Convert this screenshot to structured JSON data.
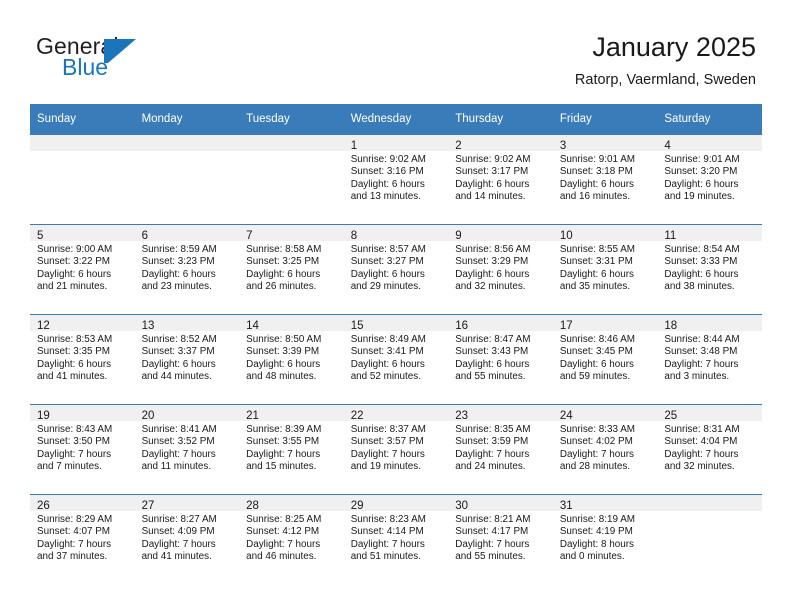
{
  "logo": {
    "word1": "General",
    "word2": "Blue",
    "icon": "triangle-logo-mark",
    "color_dark": "#231f20",
    "color_blue": "#1b75bb"
  },
  "header": {
    "title": "January 2025",
    "location": "Ratorp, Vaermland, Sweden"
  },
  "theme": {
    "header_blue": "#3a7cb9",
    "daynum_band": "#f0f0f0",
    "text": "#1a1a1a"
  },
  "calendar": {
    "weekday_headers": [
      "Sunday",
      "Monday",
      "Tuesday",
      "Wednesday",
      "Thursday",
      "Friday",
      "Saturday"
    ],
    "weeks": [
      [
        {
          "day": "",
          "sunrise": "",
          "sunset": "",
          "daylight1": "",
          "daylight2": ""
        },
        {
          "day": "",
          "sunrise": "",
          "sunset": "",
          "daylight1": "",
          "daylight2": ""
        },
        {
          "day": "",
          "sunrise": "",
          "sunset": "",
          "daylight1": "",
          "daylight2": ""
        },
        {
          "day": "1",
          "sunrise": "Sunrise: 9:02 AM",
          "sunset": "Sunset: 3:16 PM",
          "daylight1": "Daylight: 6 hours",
          "daylight2": "and 13 minutes."
        },
        {
          "day": "2",
          "sunrise": "Sunrise: 9:02 AM",
          "sunset": "Sunset: 3:17 PM",
          "daylight1": "Daylight: 6 hours",
          "daylight2": "and 14 minutes."
        },
        {
          "day": "3",
          "sunrise": "Sunrise: 9:01 AM",
          "sunset": "Sunset: 3:18 PM",
          "daylight1": "Daylight: 6 hours",
          "daylight2": "and 16 minutes."
        },
        {
          "day": "4",
          "sunrise": "Sunrise: 9:01 AM",
          "sunset": "Sunset: 3:20 PM",
          "daylight1": "Daylight: 6 hours",
          "daylight2": "and 19 minutes."
        }
      ],
      [
        {
          "day": "5",
          "sunrise": "Sunrise: 9:00 AM",
          "sunset": "Sunset: 3:22 PM",
          "daylight1": "Daylight: 6 hours",
          "daylight2": "and 21 minutes."
        },
        {
          "day": "6",
          "sunrise": "Sunrise: 8:59 AM",
          "sunset": "Sunset: 3:23 PM",
          "daylight1": "Daylight: 6 hours",
          "daylight2": "and 23 minutes."
        },
        {
          "day": "7",
          "sunrise": "Sunrise: 8:58 AM",
          "sunset": "Sunset: 3:25 PM",
          "daylight1": "Daylight: 6 hours",
          "daylight2": "and 26 minutes."
        },
        {
          "day": "8",
          "sunrise": "Sunrise: 8:57 AM",
          "sunset": "Sunset: 3:27 PM",
          "daylight1": "Daylight: 6 hours",
          "daylight2": "and 29 minutes."
        },
        {
          "day": "9",
          "sunrise": "Sunrise: 8:56 AM",
          "sunset": "Sunset: 3:29 PM",
          "daylight1": "Daylight: 6 hours",
          "daylight2": "and 32 minutes."
        },
        {
          "day": "10",
          "sunrise": "Sunrise: 8:55 AM",
          "sunset": "Sunset: 3:31 PM",
          "daylight1": "Daylight: 6 hours",
          "daylight2": "and 35 minutes."
        },
        {
          "day": "11",
          "sunrise": "Sunrise: 8:54 AM",
          "sunset": "Sunset: 3:33 PM",
          "daylight1": "Daylight: 6 hours",
          "daylight2": "and 38 minutes."
        }
      ],
      [
        {
          "day": "12",
          "sunrise": "Sunrise: 8:53 AM",
          "sunset": "Sunset: 3:35 PM",
          "daylight1": "Daylight: 6 hours",
          "daylight2": "and 41 minutes."
        },
        {
          "day": "13",
          "sunrise": "Sunrise: 8:52 AM",
          "sunset": "Sunset: 3:37 PM",
          "daylight1": "Daylight: 6 hours",
          "daylight2": "and 44 minutes."
        },
        {
          "day": "14",
          "sunrise": "Sunrise: 8:50 AM",
          "sunset": "Sunset: 3:39 PM",
          "daylight1": "Daylight: 6 hours",
          "daylight2": "and 48 minutes."
        },
        {
          "day": "15",
          "sunrise": "Sunrise: 8:49 AM",
          "sunset": "Sunset: 3:41 PM",
          "daylight1": "Daylight: 6 hours",
          "daylight2": "and 52 minutes."
        },
        {
          "day": "16",
          "sunrise": "Sunrise: 8:47 AM",
          "sunset": "Sunset: 3:43 PM",
          "daylight1": "Daylight: 6 hours",
          "daylight2": "and 55 minutes."
        },
        {
          "day": "17",
          "sunrise": "Sunrise: 8:46 AM",
          "sunset": "Sunset: 3:45 PM",
          "daylight1": "Daylight: 6 hours",
          "daylight2": "and 59 minutes."
        },
        {
          "day": "18",
          "sunrise": "Sunrise: 8:44 AM",
          "sunset": "Sunset: 3:48 PM",
          "daylight1": "Daylight: 7 hours",
          "daylight2": "and 3 minutes."
        }
      ],
      [
        {
          "day": "19",
          "sunrise": "Sunrise: 8:43 AM",
          "sunset": "Sunset: 3:50 PM",
          "daylight1": "Daylight: 7 hours",
          "daylight2": "and 7 minutes."
        },
        {
          "day": "20",
          "sunrise": "Sunrise: 8:41 AM",
          "sunset": "Sunset: 3:52 PM",
          "daylight1": "Daylight: 7 hours",
          "daylight2": "and 11 minutes."
        },
        {
          "day": "21",
          "sunrise": "Sunrise: 8:39 AM",
          "sunset": "Sunset: 3:55 PM",
          "daylight1": "Daylight: 7 hours",
          "daylight2": "and 15 minutes."
        },
        {
          "day": "22",
          "sunrise": "Sunrise: 8:37 AM",
          "sunset": "Sunset: 3:57 PM",
          "daylight1": "Daylight: 7 hours",
          "daylight2": "and 19 minutes."
        },
        {
          "day": "23",
          "sunrise": "Sunrise: 8:35 AM",
          "sunset": "Sunset: 3:59 PM",
          "daylight1": "Daylight: 7 hours",
          "daylight2": "and 24 minutes."
        },
        {
          "day": "24",
          "sunrise": "Sunrise: 8:33 AM",
          "sunset": "Sunset: 4:02 PM",
          "daylight1": "Daylight: 7 hours",
          "daylight2": "and 28 minutes."
        },
        {
          "day": "25",
          "sunrise": "Sunrise: 8:31 AM",
          "sunset": "Sunset: 4:04 PM",
          "daylight1": "Daylight: 7 hours",
          "daylight2": "and 32 minutes."
        }
      ],
      [
        {
          "day": "26",
          "sunrise": "Sunrise: 8:29 AM",
          "sunset": "Sunset: 4:07 PM",
          "daylight1": "Daylight: 7 hours",
          "daylight2": "and 37 minutes."
        },
        {
          "day": "27",
          "sunrise": "Sunrise: 8:27 AM",
          "sunset": "Sunset: 4:09 PM",
          "daylight1": "Daylight: 7 hours",
          "daylight2": "and 41 minutes."
        },
        {
          "day": "28",
          "sunrise": "Sunrise: 8:25 AM",
          "sunset": "Sunset: 4:12 PM",
          "daylight1": "Daylight: 7 hours",
          "daylight2": "and 46 minutes."
        },
        {
          "day": "29",
          "sunrise": "Sunrise: 8:23 AM",
          "sunset": "Sunset: 4:14 PM",
          "daylight1": "Daylight: 7 hours",
          "daylight2": "and 51 minutes."
        },
        {
          "day": "30",
          "sunrise": "Sunrise: 8:21 AM",
          "sunset": "Sunset: 4:17 PM",
          "daylight1": "Daylight: 7 hours",
          "daylight2": "and 55 minutes."
        },
        {
          "day": "31",
          "sunrise": "Sunrise: 8:19 AM",
          "sunset": "Sunset: 4:19 PM",
          "daylight1": "Daylight: 8 hours",
          "daylight2": "and 0 minutes."
        },
        {
          "day": "",
          "sunrise": "",
          "sunset": "",
          "daylight1": "",
          "daylight2": ""
        }
      ]
    ]
  }
}
